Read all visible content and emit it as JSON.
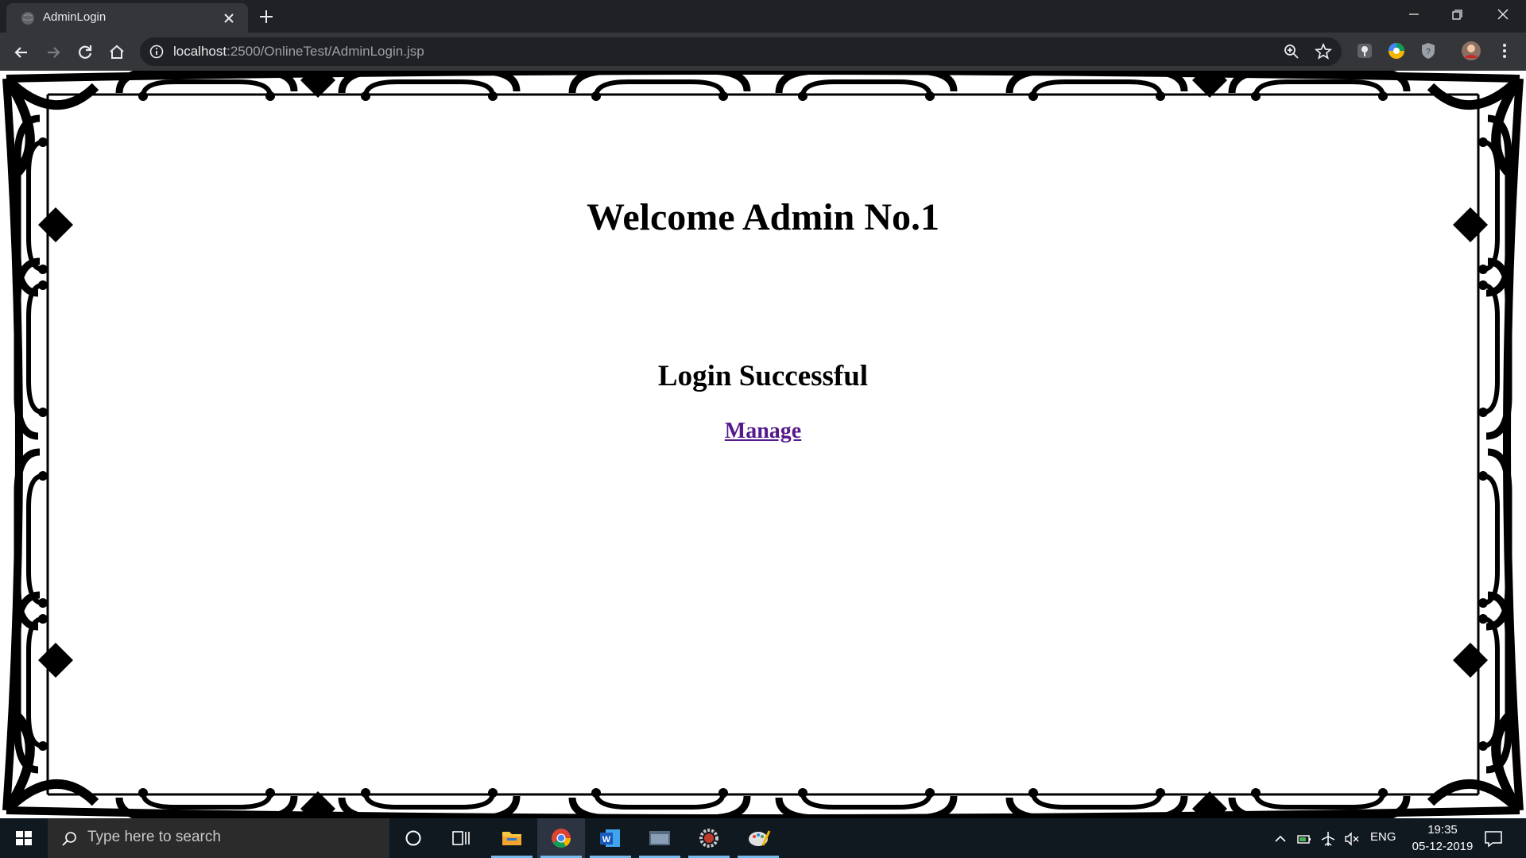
{
  "browser": {
    "tab": {
      "title": "AdminLogin"
    },
    "url": {
      "host": "localhost",
      "rest": ":2500/OnlineTest/AdminLogin.jsp"
    }
  },
  "page": {
    "welcome": "Welcome Admin No.1",
    "status": "Login Successful",
    "link": "Manage"
  },
  "taskbar": {
    "search_placeholder": "Type here to search",
    "language": "ENG",
    "time": "19:35",
    "date": "05-12-2019",
    "apps": [
      "cortana",
      "task-view",
      "file-explorer",
      "chrome",
      "word",
      "app",
      "settings",
      "paint"
    ]
  },
  "colors": {
    "link_visited": "#551a8b",
    "chrome_dark": "#202124",
    "chrome_toolbar": "#35363a",
    "taskbar": "#101820"
  }
}
